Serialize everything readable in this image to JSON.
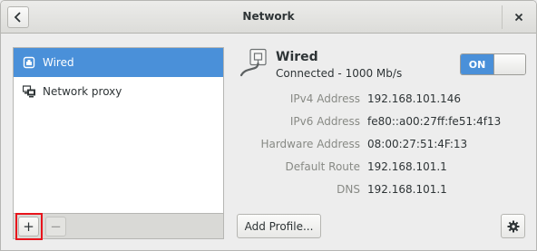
{
  "header": {
    "title": "Network",
    "back_icon": "chevron-left-icon",
    "close_icon": "close-icon"
  },
  "sidebar": {
    "items": [
      {
        "label": "Wired",
        "icon": "wired-network-icon",
        "selected": true
      },
      {
        "label": "Network proxy",
        "icon": "network-proxy-icon",
        "selected": false
      }
    ],
    "add_label": "+",
    "remove_label": "−"
  },
  "device": {
    "name": "Wired",
    "status": "Connected - 1000 Mb/s",
    "switch_label": "ON",
    "switch_on": true,
    "details": [
      {
        "label": "IPv4 Address",
        "value": "192.168.101.146"
      },
      {
        "label": "IPv6 Address",
        "value": "fe80::a00:27ff:fe51:4f13"
      },
      {
        "label": "Hardware Address",
        "value": "08:00:27:51:4F:13"
      },
      {
        "label": "Default Route",
        "value": "192.168.101.1"
      },
      {
        "label": "DNS",
        "value": "192.168.101.1"
      }
    ]
  },
  "footer": {
    "add_profile_label": "Add Profile...",
    "options_icon": "gear-icon"
  },
  "colors": {
    "accent": "#4a90d9",
    "highlight": "#e8141c"
  }
}
